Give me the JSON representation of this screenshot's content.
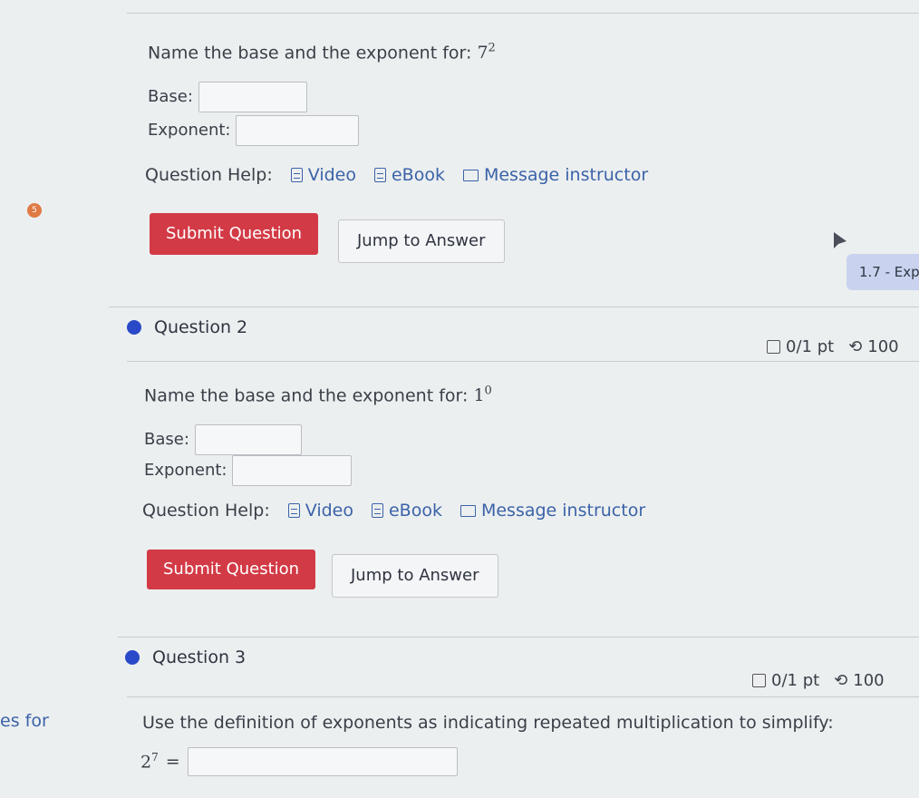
{
  "question1": {
    "prompt": "Name the base and the exponent for:",
    "base_value": "7",
    "exponent_value": "2",
    "base_label": "Base:",
    "exponent_label": "Exponent:",
    "help_label": "Question Help:",
    "video": "Video",
    "ebook": "eBook",
    "message": "Message instructor",
    "submit": "Submit Question",
    "jump": "Jump to Answer",
    "badge": "5"
  },
  "tooltip": "1.7 - Exp",
  "question2": {
    "title": "Question 2",
    "score": "0/1 pt",
    "retries": "100",
    "prompt": "Name the base and the exponent for:",
    "base_value": "1",
    "exponent_value": "0",
    "base_label": "Base:",
    "exponent_label": "Exponent:",
    "help_label": "Question Help:",
    "video": "Video",
    "ebook": "eBook",
    "message": "Message instructor",
    "submit": "Submit Question",
    "jump": "Jump to Answer"
  },
  "question3": {
    "title": "Question 3",
    "score": "0/1 pt",
    "retries": "100",
    "prompt": "Use the definition of exponents as indicating repeated multiplication to simplify:",
    "base_value": "2",
    "exponent_value": "7",
    "equals": "="
  },
  "sidebar_fragment": "es for",
  "colors": {
    "submit": "#d23a45",
    "link": "#3b63a8",
    "dot": "#2a49c8",
    "badge": "#e07a45"
  }
}
